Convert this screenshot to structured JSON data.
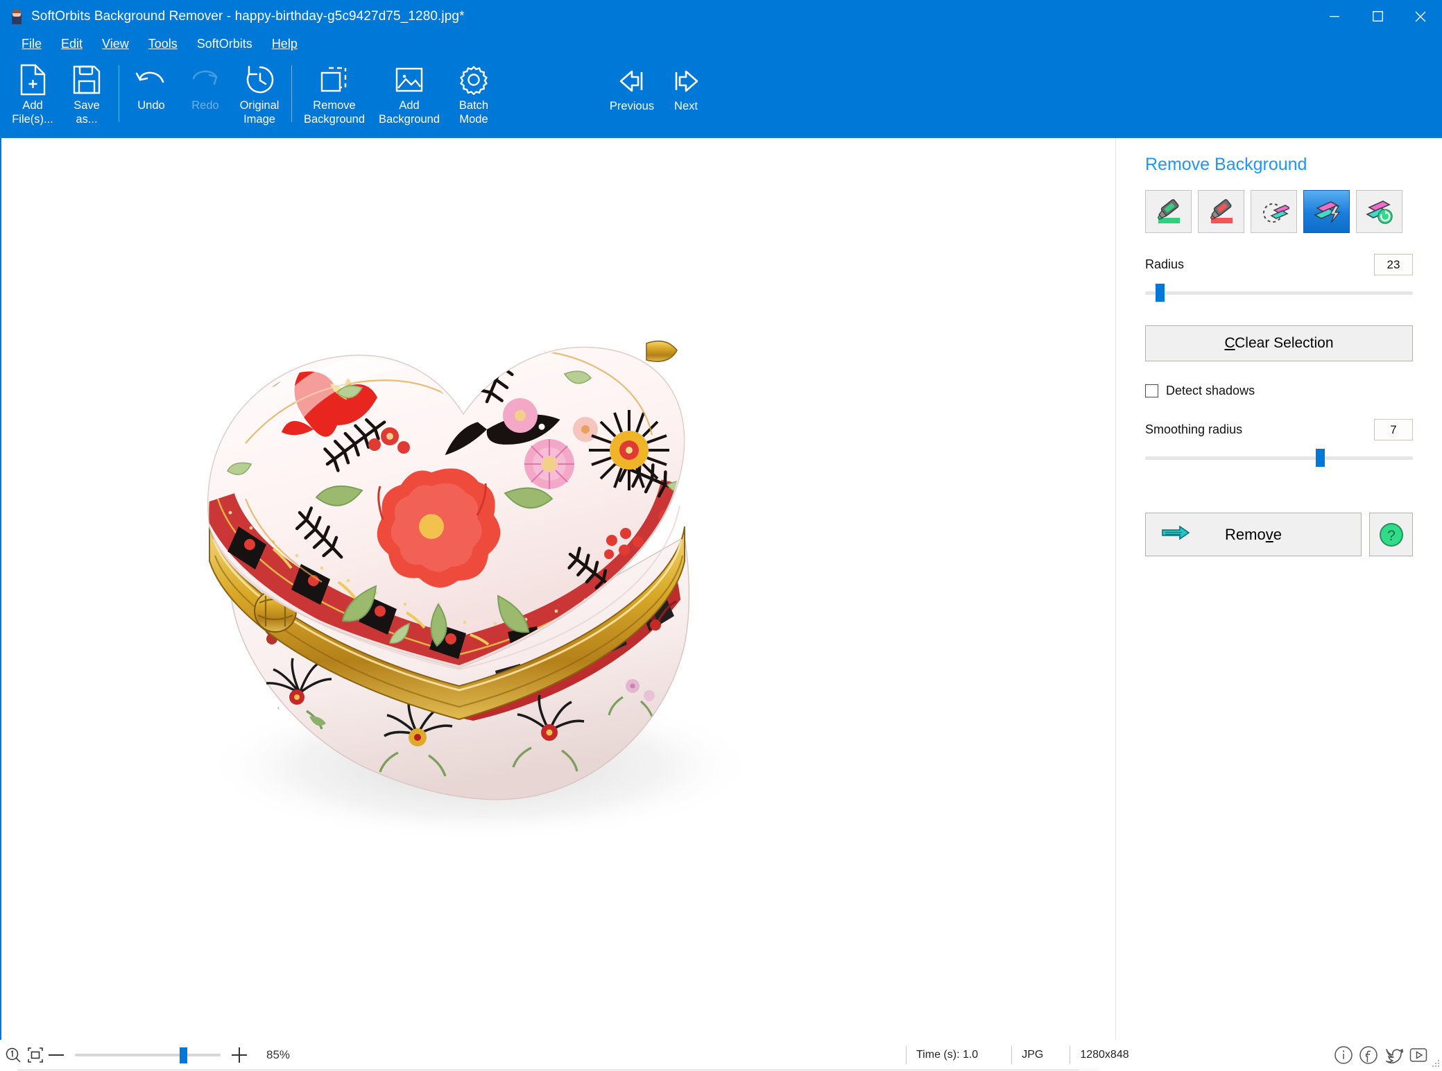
{
  "window": {
    "title": "SoftOrbits Background Remover - happy-birthday-g5c9427d75_1280.jpg*",
    "app_icon": "app-icon",
    "accent_color": "#0078d7",
    "minimize_label": "Minimize",
    "maximize_label": "Maximize",
    "close_label": "Close"
  },
  "menu": {
    "items": [
      {
        "label": "File",
        "mnemonic": "F"
      },
      {
        "label": "Edit",
        "mnemonic": "E"
      },
      {
        "label": "View",
        "mnemonic": "V"
      },
      {
        "label": "Tools",
        "mnemonic": "T"
      },
      {
        "label": "SoftOrbits",
        "mnemonic": ""
      },
      {
        "label": "Help",
        "mnemonic": "H"
      }
    ]
  },
  "toolbar": {
    "buttons": [
      {
        "label": "Add\nFile(s)...",
        "icon": "add-file-icon",
        "disabled": false
      },
      {
        "label": "Save\nas...",
        "icon": "save-as-icon",
        "disabled": false
      },
      {
        "label": "Undo",
        "icon": "undo-icon",
        "disabled": false
      },
      {
        "label": "Redo",
        "icon": "redo-icon",
        "disabled": true
      },
      {
        "label": "Original\nImage",
        "icon": "original-image-icon",
        "disabled": false
      },
      {
        "label": "Remove\nBackground",
        "icon": "remove-background-icon",
        "disabled": false
      },
      {
        "label": "Add\nBackground",
        "icon": "add-background-icon",
        "disabled": false
      },
      {
        "label": "Batch\nMode",
        "icon": "batch-mode-icon",
        "disabled": false
      }
    ],
    "nav": [
      {
        "label": "Previous",
        "icon": "previous-icon"
      },
      {
        "label": "Next",
        "icon": "next-icon"
      }
    ]
  },
  "panel": {
    "title": "Remove Background",
    "tools": [
      {
        "name": "mark-foreground-tool",
        "icon": "green-marker-icon",
        "selected": false
      },
      {
        "name": "mark-background-tool",
        "icon": "red-marker-icon",
        "selected": false
      },
      {
        "name": "erase-marks-tool",
        "icon": "eraser-icon",
        "selected": false
      },
      {
        "name": "magic-wand-tool",
        "icon": "auto-select-icon",
        "selected": true
      },
      {
        "name": "restore-tool",
        "icon": "restore-icon",
        "selected": false
      }
    ],
    "radius": {
      "label": "Radius",
      "value": "23",
      "percent": 4
    },
    "clear_selection": {
      "label": "Clear Selection",
      "mnemonic": "C"
    },
    "detect_shadows": {
      "label": "Detect shadows",
      "checked": false
    },
    "smoothing_radius": {
      "label": "Smoothing radius",
      "value": "7",
      "percent": 66
    },
    "remove": {
      "label": "Remove",
      "mnemonic": "v",
      "icon": "arrow-right-icon"
    },
    "help": {
      "icon": "question-mark-icon"
    }
  },
  "canvas": {
    "image_alt": "heart-shaped floral porcelain trinket box on white background"
  },
  "statusbar": {
    "zoom_fit_icon": "zoom-one-to-one-icon",
    "fit_screen_icon": "fit-to-screen-icon",
    "zoom_out_label": "—",
    "zoom_in_label": "+",
    "zoom_percent": "85%",
    "zoom_slider_percent": 76,
    "time_label": "Time (s): 1.0",
    "format_label": "JPG",
    "dimensions_label": "1280x848",
    "social": [
      {
        "name": "info-icon"
      },
      {
        "name": "facebook-icon"
      },
      {
        "name": "twitter-icon"
      },
      {
        "name": "youtube-icon"
      }
    ]
  },
  "scrollbar": {
    "left_arrow": "chevron-left-icon",
    "right_arrow": "chevron-right-icon"
  }
}
